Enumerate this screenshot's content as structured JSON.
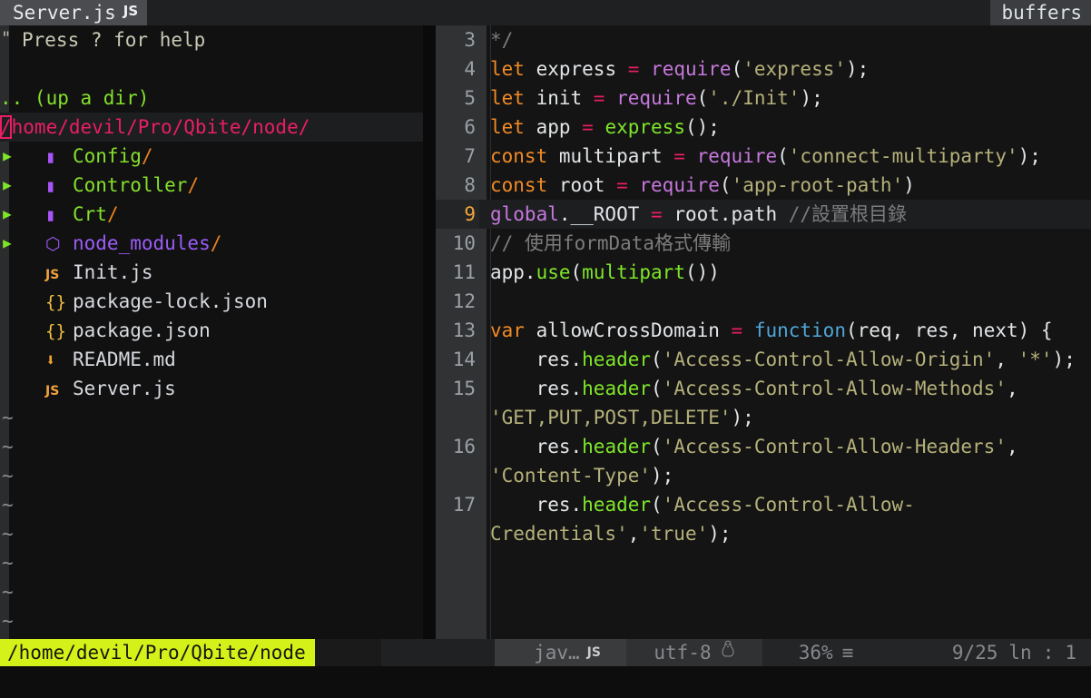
{
  "window": {
    "tab_label": "Server.js",
    "tab_filetype_badge": "JS",
    "buffers_label": "buffers"
  },
  "tree": {
    "help_marker": "\"",
    "help_text": "Press ? for help",
    "up_dir": ".. (up a dir)",
    "current_path": "/home/devil/Pro/Qbite/node/",
    "items": [
      {
        "arrow": "▶",
        "icon": "folder-icon",
        "glyph": "▮",
        "name": "Config",
        "suffix": "/",
        "kind": "dir"
      },
      {
        "arrow": "▶",
        "icon": "folder-icon",
        "glyph": "▮",
        "name": "Controller",
        "suffix": "/",
        "kind": "dir"
      },
      {
        "arrow": "▶",
        "icon": "folder-icon",
        "glyph": "▮",
        "name": "Crt",
        "suffix": "/",
        "kind": "dir"
      },
      {
        "arrow": "▶",
        "icon": "nodejs-icon",
        "glyph": "⬡",
        "name": "node_modules",
        "suffix": "/",
        "kind": "node_modules"
      },
      {
        "arrow": "",
        "icon": "js-file-icon",
        "glyph": "JS",
        "name": "Init.js",
        "suffix": "",
        "kind": "file"
      },
      {
        "arrow": "",
        "icon": "json-file-icon",
        "glyph": "{}",
        "name": "package-lock.json",
        "suffix": "",
        "kind": "file"
      },
      {
        "arrow": "",
        "icon": "json-file-icon",
        "glyph": "{}",
        "name": "package.json",
        "suffix": "",
        "kind": "file"
      },
      {
        "arrow": "",
        "icon": "markdown-file-icon",
        "glyph": "⬇",
        "name": "README.md",
        "suffix": "",
        "kind": "file"
      },
      {
        "arrow": "",
        "icon": "js-file-icon",
        "glyph": "JS",
        "name": "Server.js",
        "suffix": "",
        "kind": "file"
      }
    ],
    "empty_marker": "~",
    "empty_rows": 8
  },
  "editor": {
    "lines": [
      {
        "num": "3",
        "current": false,
        "tokens": [
          {
            "t": "*/",
            "c": "cmt"
          }
        ]
      },
      {
        "num": "4",
        "current": false,
        "tokens": [
          {
            "t": "let",
            "c": "kw"
          },
          {
            "t": " express ",
            "c": "plain"
          },
          {
            "t": "=",
            "c": "op"
          },
          {
            "t": " ",
            "c": "plain"
          },
          {
            "t": "require",
            "c": "fn"
          },
          {
            "t": "(",
            "c": "punc"
          },
          {
            "t": "'express'",
            "c": "str"
          },
          {
            "t": ");",
            "c": "punc"
          }
        ]
      },
      {
        "num": "5",
        "current": false,
        "tokens": [
          {
            "t": "let",
            "c": "kw"
          },
          {
            "t": " init ",
            "c": "plain"
          },
          {
            "t": "=",
            "c": "op"
          },
          {
            "t": " ",
            "c": "plain"
          },
          {
            "t": "require",
            "c": "fn"
          },
          {
            "t": "(",
            "c": "punc"
          },
          {
            "t": "'./Init'",
            "c": "str"
          },
          {
            "t": ");",
            "c": "punc"
          }
        ]
      },
      {
        "num": "6",
        "current": false,
        "tokens": [
          {
            "t": "let",
            "c": "kw"
          },
          {
            "t": " app ",
            "c": "plain"
          },
          {
            "t": "=",
            "c": "op"
          },
          {
            "t": " ",
            "c": "plain"
          },
          {
            "t": "express",
            "c": "meth"
          },
          {
            "t": "();",
            "c": "punc"
          }
        ]
      },
      {
        "num": "7",
        "current": false,
        "tokens": [
          {
            "t": "const",
            "c": "kw"
          },
          {
            "t": " multipart ",
            "c": "plain"
          },
          {
            "t": "=",
            "c": "op"
          },
          {
            "t": " ",
            "c": "plain"
          },
          {
            "t": "require",
            "c": "fn"
          },
          {
            "t": "(",
            "c": "punc"
          },
          {
            "t": "'connect-multiparty'",
            "c": "str"
          },
          {
            "t": ");",
            "c": "punc"
          }
        ]
      },
      {
        "num": "8",
        "current": false,
        "tokens": [
          {
            "t": "const",
            "c": "kw"
          },
          {
            "t": " root ",
            "c": "plain"
          },
          {
            "t": "=",
            "c": "op"
          },
          {
            "t": " ",
            "c": "plain"
          },
          {
            "t": "require",
            "c": "fn"
          },
          {
            "t": "(",
            "c": "punc"
          },
          {
            "t": "'app-root-path'",
            "c": "str"
          },
          {
            "t": ")",
            "c": "punc"
          }
        ]
      },
      {
        "num": "9",
        "current": true,
        "tokens": [
          {
            "t": "global",
            "c": "glob"
          },
          {
            "t": ".__ROOT ",
            "c": "plain"
          },
          {
            "t": "=",
            "c": "op"
          },
          {
            "t": " root.path ",
            "c": "plain"
          },
          {
            "t": "//設置根目錄",
            "c": "cmt"
          }
        ]
      },
      {
        "num": "10",
        "current": false,
        "tokens": [
          {
            "t": "// 使用formData格式傳輸",
            "c": "cmt"
          }
        ]
      },
      {
        "num": "11",
        "current": false,
        "tokens": [
          {
            "t": "app.",
            "c": "plain"
          },
          {
            "t": "use",
            "c": "meth"
          },
          {
            "t": "(",
            "c": "punc"
          },
          {
            "t": "multipart",
            "c": "meth"
          },
          {
            "t": "())",
            "c": "punc"
          }
        ]
      },
      {
        "num": "12",
        "current": false,
        "tokens": [
          {
            "t": "",
            "c": "plain"
          }
        ]
      },
      {
        "num": "13",
        "current": false,
        "tokens": [
          {
            "t": "var",
            "c": "kw"
          },
          {
            "t": " allowCrossDomain ",
            "c": "plain"
          },
          {
            "t": "=",
            "c": "op"
          },
          {
            "t": " ",
            "c": "plain"
          },
          {
            "t": "function",
            "c": "fnkw"
          },
          {
            "t": "(req, res, next) {",
            "c": "punc"
          }
        ]
      },
      {
        "num": "14",
        "current": false,
        "tokens": [
          {
            "t": "    res.",
            "c": "plain"
          },
          {
            "t": "header",
            "c": "meth"
          },
          {
            "t": "(",
            "c": "punc"
          },
          {
            "t": "'Access-Control-Allow-Origin'",
            "c": "str"
          },
          {
            "t": ", ",
            "c": "punc"
          },
          {
            "t": "'*'",
            "c": "str"
          },
          {
            "t": ");",
            "c": "punc"
          }
        ]
      },
      {
        "num": "15",
        "current": false,
        "tokens": [
          {
            "t": "    res.",
            "c": "plain"
          },
          {
            "t": "header",
            "c": "meth"
          },
          {
            "t": "(",
            "c": "punc"
          },
          {
            "t": "'Access-Control-Allow-Methods'",
            "c": "str"
          },
          {
            "t": ", ",
            "c": "punc"
          },
          {
            "t": "'GET,PUT,POST,DELETE'",
            "c": "str"
          },
          {
            "t": ");",
            "c": "punc"
          }
        ]
      },
      {
        "num": "16",
        "current": false,
        "tokens": [
          {
            "t": "    res.",
            "c": "plain"
          },
          {
            "t": "header",
            "c": "meth"
          },
          {
            "t": "(",
            "c": "punc"
          },
          {
            "t": "'Access-Control-Allow-Headers'",
            "c": "str"
          },
          {
            "t": ", ",
            "c": "punc"
          },
          {
            "t": "'Content-Type'",
            "c": "str"
          },
          {
            "t": ");",
            "c": "punc"
          }
        ]
      },
      {
        "num": "17",
        "current": false,
        "tokens": [
          {
            "t": "    res.",
            "c": "plain"
          },
          {
            "t": "header",
            "c": "meth"
          },
          {
            "t": "(",
            "c": "punc"
          },
          {
            "t": "'Access-Control-Allow-Credentials'",
            "c": "str"
          },
          {
            "t": ",",
            "c": "punc"
          },
          {
            "t": "'true'",
            "c": "str"
          },
          {
            "t": ");",
            "c": "punc"
          }
        ]
      }
    ]
  },
  "statusline": {
    "path": "/home/devil/Pro/Qbite/node",
    "left_arrow": "<",
    "filetype": "jav…",
    "filetype_badge": "JS",
    "encoding": "utf-8",
    "os_icon": "🐧",
    "percent": "36%",
    "percent_icon": "≡",
    "position": "9/25",
    "position_unit": "ln",
    "position_sep": ":",
    "column": "1"
  },
  "colors": {
    "accent_path": "#e91e63",
    "dir_green": "#84e02a",
    "status_highlight": "#d4f21a",
    "keyword": "#f08a26",
    "string": "#b5b17a",
    "function": "#c678dd",
    "comment": "#7c7c7c"
  }
}
